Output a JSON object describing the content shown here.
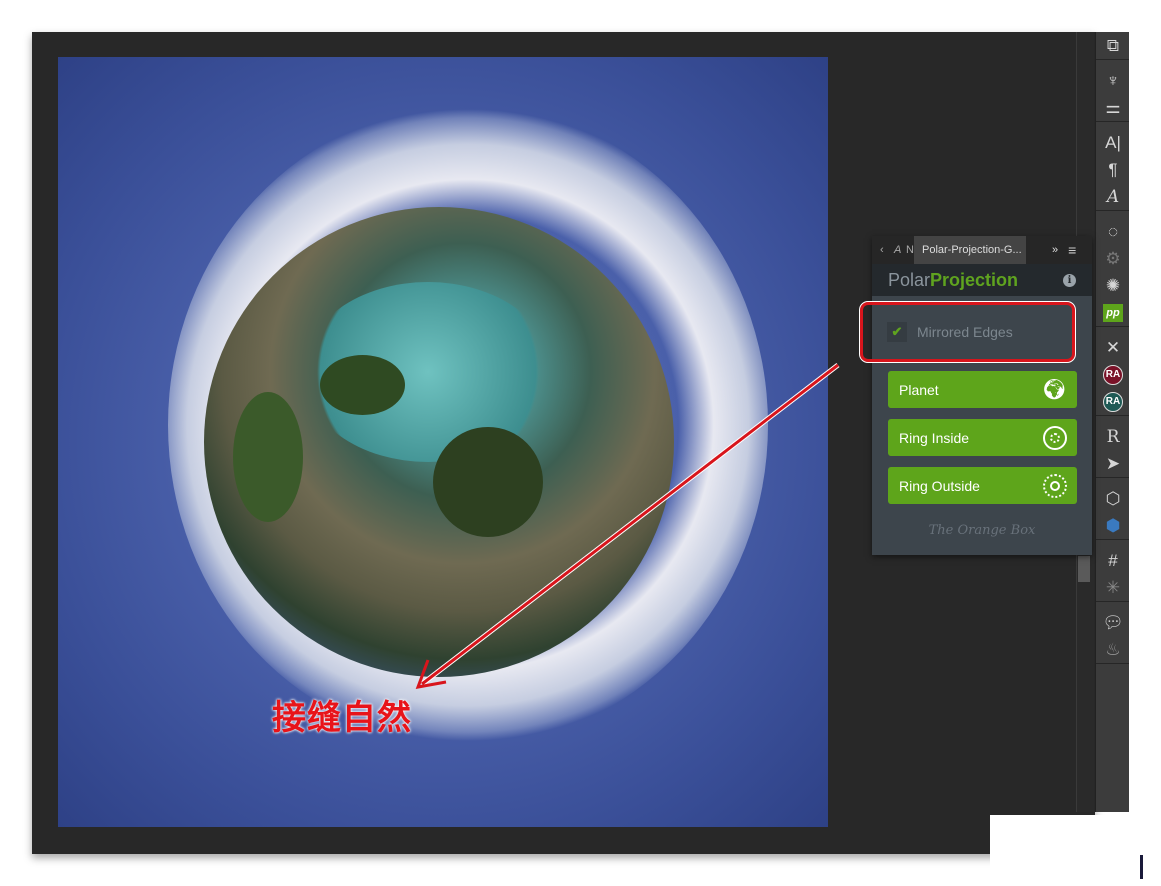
{
  "annotation": {
    "text": "接缝自然",
    "color": "#e8141a"
  },
  "panel": {
    "tab_collapsed_1": "‹",
    "tab_collapsed_2": "A",
    "tab_collapsed_3": "N",
    "tab_title": "Polar-Projection-G...",
    "expand": "»",
    "menu": "≡",
    "title_part1": "Polar",
    "title_part2": "Projection",
    "info": "i",
    "mirrored_edges": {
      "label": "Mirrored Edges",
      "checked": true
    },
    "buttons": [
      {
        "label": "Planet",
        "icon": "planet-icon"
      },
      {
        "label": "Ring Inside",
        "icon": "ring-inside-icon"
      },
      {
        "label": "Ring Outside",
        "icon": "ring-outside-icon"
      }
    ],
    "logo": "The Orange Box",
    "accent": "#5ea51b"
  },
  "toolbar": {
    "icons": [
      "arrange-icon",
      "brushes-icon",
      "adjust-icon",
      "character-icon",
      "paragraph-icon",
      "glyphs-icon",
      "history-icon",
      "plugin-icon",
      "aperture-icon",
      "pp-icon",
      "tools-icon",
      "ra-red-icon",
      "ra-teal-icon",
      "rpro-icon",
      "bird-icon",
      "cube-icon",
      "cube-3d-icon",
      "grid-icon",
      "sparkle-icon",
      "comment-icon",
      "fire-icon"
    ],
    "pp_label": "pp",
    "ra_label": "RA",
    "r_label": "R"
  }
}
